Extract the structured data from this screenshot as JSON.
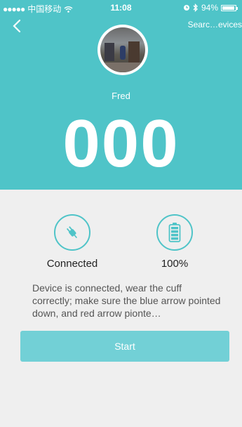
{
  "colors": {
    "accent": "#4fc4c8",
    "start_button": "#72d0d6",
    "background": "#efefef"
  },
  "status_bar": {
    "signal_dots": "●●●●●",
    "carrier": "中国移动",
    "time": "11:08",
    "battery_percent": "94%",
    "battery_level": 0.94
  },
  "header": {
    "search_link": "Searc…evices",
    "user_name": "Fred",
    "reading": "000"
  },
  "device_status": {
    "connection_label": "Connected",
    "battery_label": "100%"
  },
  "instructions": "Device is connected, wear the cuff correctly; make sure the blue arrow pointed down, and red arrow pionte…",
  "actions": {
    "start_label": "Start"
  }
}
